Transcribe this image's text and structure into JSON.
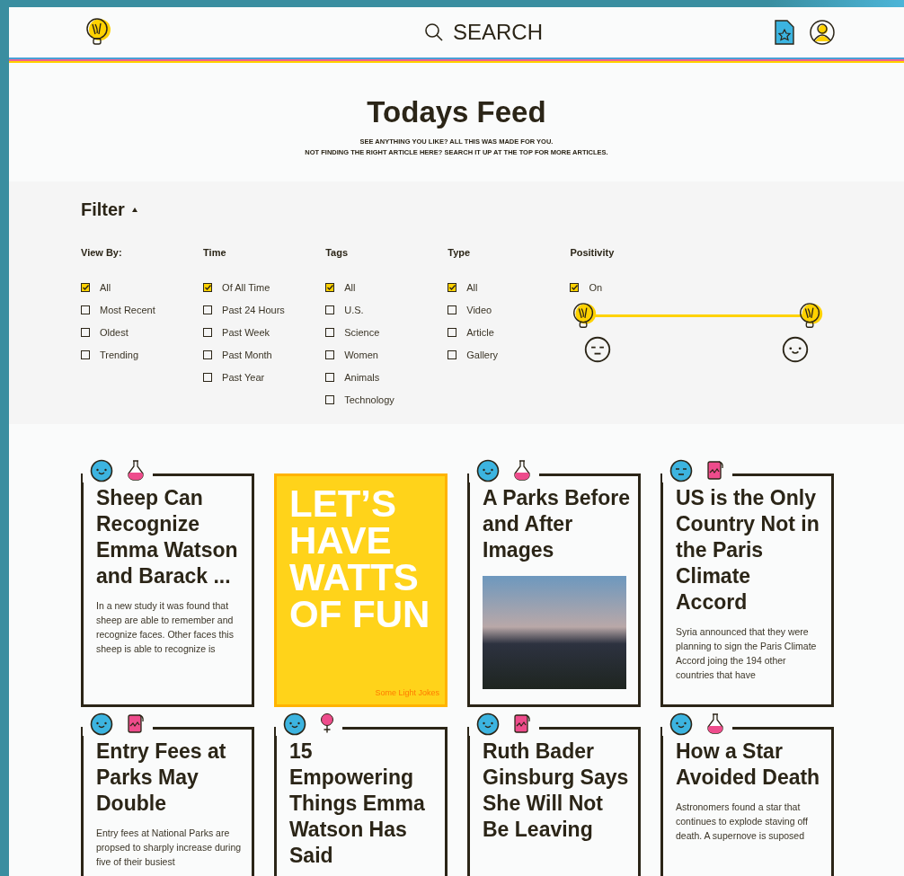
{
  "header": {
    "search": {
      "label": "SEARCH"
    }
  },
  "intro": {
    "title": "Todays Feed",
    "lines": [
      "SEE ANYTHING YOU LIKE? ALL THIS WAS MADE FOR YOU.",
      "NOT FINDING THE RIGHT ARTICLE HERE? SEARCH IT UP AT THE TOP FOR MORE ARTICLES."
    ]
  },
  "filter": {
    "title": "Filter",
    "expanded": true,
    "groups": [
      {
        "heading": "View By:",
        "options": [
          {
            "label": "All",
            "checked": true
          },
          {
            "label": "Most Recent",
            "checked": false
          },
          {
            "label": "Oldest",
            "checked": false
          },
          {
            "label": "Trending",
            "checked": false
          }
        ]
      },
      {
        "heading": "Time",
        "options": [
          {
            "label": "Of All Time",
            "checked": true
          },
          {
            "label": "Past 24 Hours",
            "checked": false
          },
          {
            "label": "Past Week",
            "checked": false
          },
          {
            "label": "Past Month",
            "checked": false
          },
          {
            "label": "Past Year",
            "checked": false
          }
        ]
      },
      {
        "heading": "Tags",
        "options": [
          {
            "label": "All",
            "checked": true
          },
          {
            "label": "U.S.",
            "checked": false
          },
          {
            "label": "Science",
            "checked": false
          },
          {
            "label": "Women",
            "checked": false
          },
          {
            "label": "Animals",
            "checked": false
          },
          {
            "label": "Technology",
            "checked": false
          }
        ]
      },
      {
        "heading": "Type",
        "options": [
          {
            "label": "All",
            "checked": true
          },
          {
            "label": "Video",
            "checked": false
          },
          {
            "label": "Article",
            "checked": false
          },
          {
            "label": "Gallery",
            "checked": false
          }
        ]
      }
    ],
    "positivity": {
      "heading": "Positivity",
      "toggle": {
        "label": "On",
        "checked": true
      },
      "thumbs": [
        {
          "level": 0
        },
        {
          "level": 1
        }
      ]
    }
  },
  "cards": [
    {
      "kind": "text",
      "badges": [
        {
          "kind": "smile"
        },
        {
          "kind": "flask"
        }
      ],
      "title": "Sheep Can Recognize Emma Watson and Barack ...",
      "excerpt": "In a new study it was found that sheep are able to remember and recognize faces. Other faces this sheep is able to recognize is"
    },
    {
      "kind": "promo",
      "title": "LET’S HAVE WATTS OF FUN",
      "caption": "Some Light Jokes"
    },
    {
      "kind": "image",
      "badges": [
        {
          "kind": "smile"
        },
        {
          "kind": "flask"
        }
      ],
      "title": "A Parks Before and After Images"
    },
    {
      "kind": "text",
      "badges": [
        {
          "kind": "sleepy"
        },
        {
          "kind": "chart"
        }
      ],
      "title": "US is the Only Country Not in the Paris Climate Accord",
      "excerpt": "Syria announced that they were planning to sign the Paris Climate Accord joing the 194 other countries that have"
    },
    {
      "kind": "text",
      "badges": [
        {
          "kind": "smile"
        },
        {
          "kind": "chart"
        }
      ],
      "title": "Entry Fees at Parks May Double",
      "excerpt": "Entry fees at National Parks are propsed to sharply increase during five of their busiest"
    },
    {
      "kind": "text",
      "badges": [
        {
          "kind": "smile"
        },
        {
          "kind": "female"
        }
      ],
      "title": "15 Empowering Things Emma Watson Has Said"
    },
    {
      "kind": "text",
      "badges": [
        {
          "kind": "smile"
        },
        {
          "kind": "chart"
        }
      ],
      "title": "Ruth Bader Ginsburg Says She Will Not Be Leaving"
    },
    {
      "kind": "text",
      "badges": [
        {
          "kind": "smile"
        },
        {
          "kind": "flask"
        }
      ],
      "title": "How a Star Avoided Death",
      "excerpt": "Astronomers found a star that continues to explode staving off death. A supernove is suposed"
    }
  ]
}
